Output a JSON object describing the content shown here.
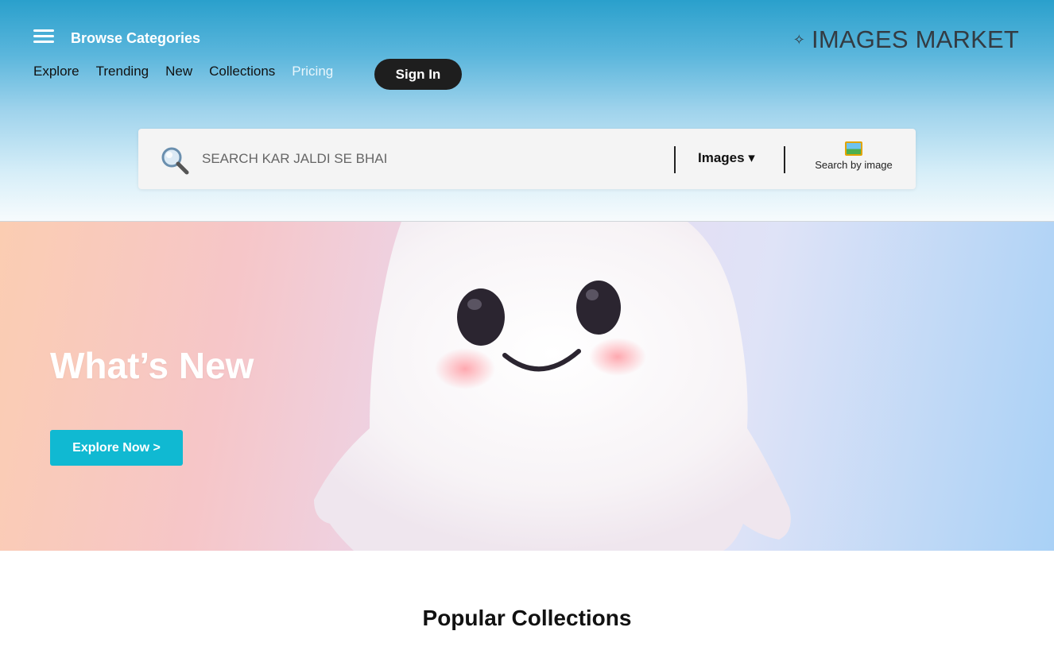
{
  "header": {
    "browse_label": "Browse Categories",
    "brand": "IMAGES MARKET",
    "brand_icon": "sparkle-icon",
    "nav": [
      "Explore",
      "Trending",
      "New",
      "Collections",
      "Pricing"
    ],
    "signin_label": "Sign In"
  },
  "search": {
    "placeholder": "SEARCH KAR JALDI SE BHAI",
    "type_label": "Images ▾",
    "search_by_image_label": "Search by image"
  },
  "hero": {
    "title": "What’s New",
    "button_label": "Explore Now >"
  },
  "section": {
    "title": "Popular Collections"
  },
  "colors": {
    "header_top": "#2aa0cc",
    "accent_button": "#10b9d2",
    "signin_bg": "#1e1e1e"
  }
}
